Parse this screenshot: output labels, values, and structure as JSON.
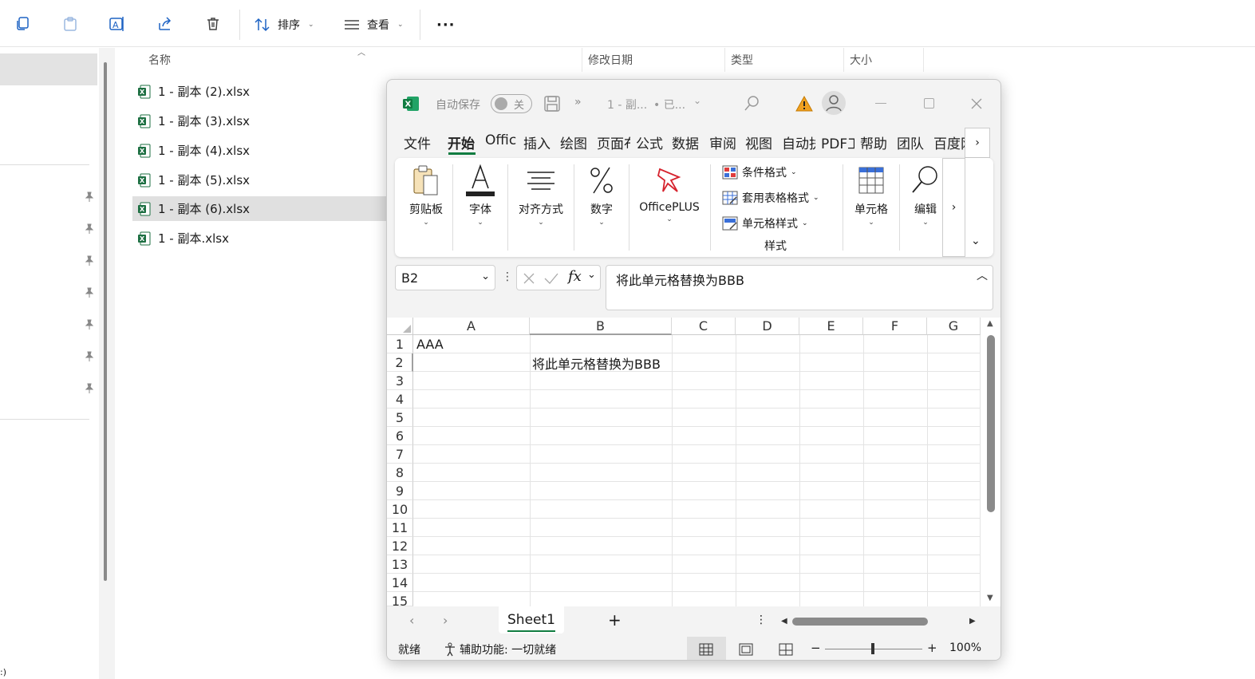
{
  "explorer": {
    "toolbar": {
      "sort_label": "排序",
      "view_label": "查看",
      "more_label": "···"
    },
    "columns": {
      "name": "名称",
      "modified": "修改日期",
      "type": "类型",
      "size": "大小"
    },
    "files": [
      {
        "name": "1 - 副本 (2).xlsx"
      },
      {
        "name": "1 - 副本 (3).xlsx"
      },
      {
        "name": "1 - 副本 (4).xlsx"
      },
      {
        "name": "1 - 副本 (5).xlsx"
      },
      {
        "name": "1 - 副本 (6).xlsx"
      },
      {
        "name": "1 - 副本.xlsx"
      }
    ],
    "bottom_glyph": ":)"
  },
  "excel": {
    "titlebar": {
      "autosave_label": "自动保存",
      "toggle_label": "关",
      "more_label": "»",
      "doc_title": "1 - 副...",
      "saved_status": "• 已..."
    },
    "tabs": [
      "文件",
      "开始",
      "Offic",
      "插入",
      "绘图",
      "页面布",
      "公式",
      "数据",
      "审阅",
      "视图",
      "自动执",
      "PDF工",
      "帮助",
      "团队",
      "百度网"
    ],
    "tab_more": "›",
    "ribbon": {
      "clipboard": "剪贴板",
      "font": "字体",
      "alignment": "对齐方式",
      "number": "数字",
      "officeplus": "OfficePLUS",
      "cond_format": "条件格式",
      "table_format": "套用表格格式",
      "cell_style": "单元格样式",
      "styles_group": "样式",
      "cells": "单元格",
      "editing": "编辑",
      "more": "›",
      "collapse": "⌄"
    },
    "formula_bar": {
      "name_box": "B2",
      "fx": "fx",
      "content": "将此单元格替换为BBB"
    },
    "columns": [
      "A",
      "B",
      "C",
      "D",
      "E",
      "F",
      "G"
    ],
    "rows": [
      "1",
      "2",
      "3",
      "4",
      "5",
      "6",
      "7",
      "8",
      "9",
      "10",
      "11",
      "12",
      "13",
      "14",
      "15"
    ],
    "cells": {
      "A1": "AAA",
      "B2": "将此单元格替换为BBB"
    },
    "sheet_tab": "Sheet1",
    "add_sheet": "+",
    "status": {
      "ready": "就绪",
      "accessibility": "辅助功能: 一切就绪",
      "zoom": "100%",
      "zoom_minus": "−",
      "zoom_plus": "+"
    }
  }
}
